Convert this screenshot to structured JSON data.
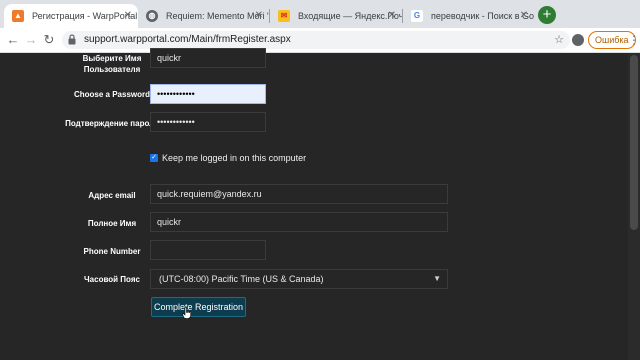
{
  "browser": {
    "tabs": [
      {
        "title": "Регистрация - WarpPortal",
        "favicon": "warpportal-icon",
        "color": "#f07a2c",
        "active": true
      },
      {
        "title": "Requiem: Memento Mori \"Free",
        "favicon": "globe-icon",
        "color": "#5f6368",
        "active": false
      },
      {
        "title": "Входящие — Яндекс.Почта",
        "favicon": "yandex-mail-icon",
        "color": "#f8bf1c",
        "active": false
      },
      {
        "title": "переводчик - Поиск в Google",
        "favicon": "google-icon",
        "color": "#4285f4",
        "active": false
      }
    ],
    "url": "support.warpportal.com/Main/frmRegister.aspx",
    "error_badge": "Ошибка"
  },
  "form": {
    "username_label": "Выберите Имя Пользователя",
    "username_value": "quickr",
    "password_label": "Choose a Password",
    "password_value": "••••••••••••",
    "confirm_label": "Подтверждение пароля",
    "confirm_value": "••••••••••••",
    "keep_logged_in": {
      "label": "Keep me logged in on this computer",
      "checked": true
    },
    "email_label": "Адрес email",
    "email_value": "quick.requiem@yandex.ru",
    "fullname_label": "Полное Имя",
    "fullname_value": "quickr",
    "phone_label": "Phone Number",
    "phone_value": "",
    "timezone_label": "Часовой Пояс",
    "timezone_value": "(UTC-08:00) Pacific Time (US & Canada)",
    "submit_label": "Complete Registration"
  }
}
